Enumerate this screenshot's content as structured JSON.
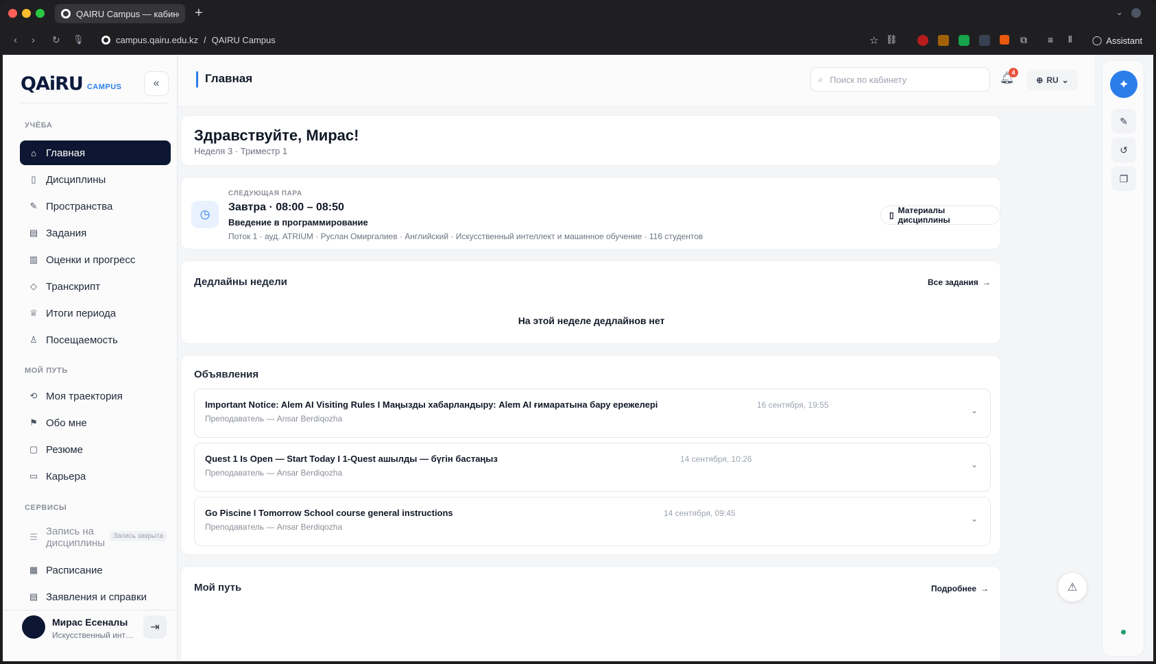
{
  "browser": {
    "tab_title": "QAIRU Campus — кабинет с",
    "url_domain": "campus.qairu.edu.kz",
    "url_sep": "/",
    "url_page": "QAIRU Campus",
    "assistant_label": "Assistant",
    "new_tab_glyph": "+"
  },
  "sidebar": {
    "logo_main": "QAiRU",
    "logo_sub": "CAMPUS",
    "sections": {
      "study": "УЧЁБА",
      "path": "МОЙ ПУТЬ",
      "services": "СЕРВИСЫ"
    },
    "study_items": [
      {
        "label": "Главная",
        "icon": "home-icon"
      },
      {
        "label": "Дисциплины",
        "icon": "book-icon"
      },
      {
        "label": "Пространства",
        "icon": "edit-icon"
      },
      {
        "label": "Задания",
        "icon": "clipboard-icon"
      },
      {
        "label": "Оценки и прогресс",
        "icon": "bar-chart-icon"
      },
      {
        "label": "Транскрипт",
        "icon": "graduation-cap-icon"
      },
      {
        "label": "Итоги периода",
        "icon": "trophy-icon"
      },
      {
        "label": "Посещаемость",
        "icon": "user-check-icon"
      }
    ],
    "path_items": [
      {
        "label": "Моя траектория",
        "icon": "route-icon"
      },
      {
        "label": "Обо мне",
        "icon": "flag-icon"
      },
      {
        "label": "Резюме",
        "icon": "resume-icon"
      },
      {
        "label": "Карьера",
        "icon": "briefcase-icon"
      }
    ],
    "service_items": [
      {
        "label": "Запись на дисциплины",
        "icon": "list-check-icon",
        "badge": "Запись закрыта"
      },
      {
        "label": "Расписание",
        "icon": "calendar-icon"
      },
      {
        "label": "Заявления и справки",
        "icon": "document-icon"
      }
    ],
    "user": {
      "name": "Мирас Есеналы",
      "program": "Искусственный инте..."
    }
  },
  "header": {
    "title": "Главная",
    "search_placeholder": "Поиск по кабинету",
    "notifications_count": "4",
    "language": "RU"
  },
  "greeting": {
    "title": "Здравствуйте, Мирас!",
    "subtitle": "Неделя 3 · Триместр 1"
  },
  "next_class": {
    "label": "СЛЕДУЮЩАЯ ПАРА",
    "time": "Завтра · 08:00 – 08:50",
    "course": "Введение в программирование",
    "meta": "Поток 1 · ауд. ATRIUM · Руслан Омиргалиев · Английский · Искусственный интеллект и машинное обучение · 116 студентов",
    "materials_button": "Материалы дисциплины"
  },
  "deadlines": {
    "title": "Дедлайны недели",
    "all_link": "Все задания",
    "empty_text": "На этой неделе дедлайнов нет"
  },
  "announcements": {
    "title": "Объявления",
    "items": [
      {
        "title": "Important Notice: Alem AI Visiting Rules I Маңызды хабарландыру: Alem AI ғимаратына бару ережелері",
        "author": "Преподаватель — Ansar Berdiqozha",
        "date": "16 сентября, 19:55"
      },
      {
        "title": "Quest 1 Is Open — Start Today I 1-Quest ашылды — бүгін бастаңыз",
        "author": "Преподаватель — Ansar Berdiqozha",
        "date": "14 сентября, 10:26"
      },
      {
        "title": "Go Piscine I Tomorrow School course general instructions",
        "author": "Преподаватель — Ansar Berdiqozha",
        "date": "14 сентября, 09:45"
      }
    ]
  },
  "my_path": {
    "title": "Мой путь",
    "more_link": "Подробнее"
  },
  "colors": {
    "accent": "#2b7de9",
    "nav_active": "#0d1733",
    "badge": "#e8523f"
  }
}
